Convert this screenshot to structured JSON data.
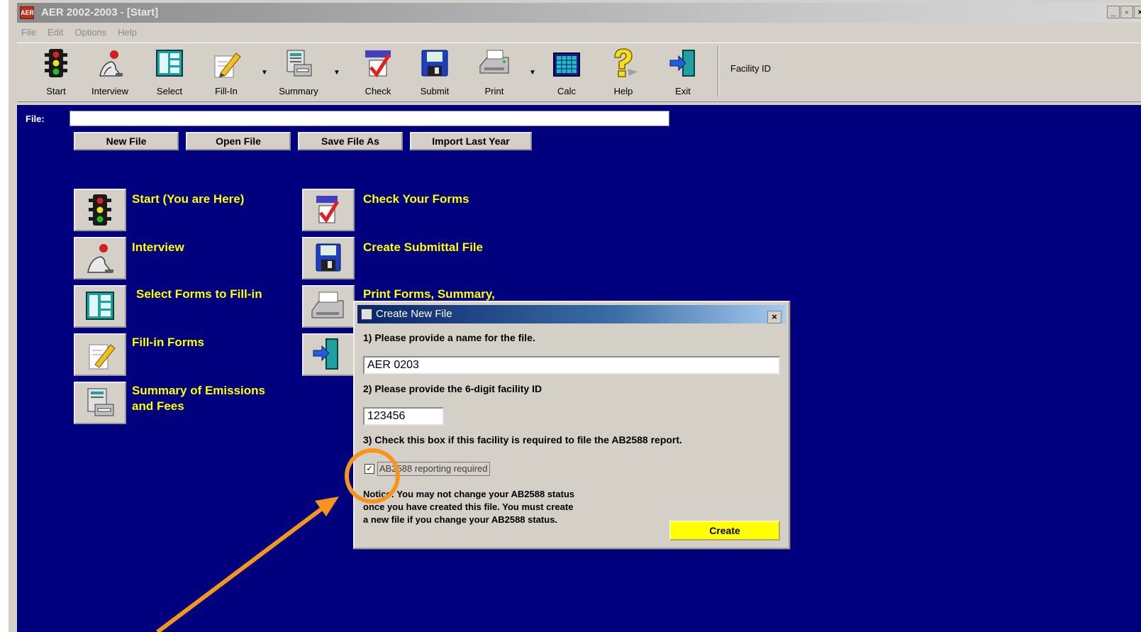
{
  "window": {
    "title": "AER 2002-2003 - [Start]",
    "app_icon_text": "AER",
    "controls": [
      "_",
      "▫",
      "×"
    ]
  },
  "menu": [
    "File",
    "Edit",
    "Options",
    "Help"
  ],
  "toolbar": {
    "items": [
      {
        "label": "Start",
        "icon": "traffic-light-icon"
      },
      {
        "label": "Interview",
        "icon": "interviewer-icon"
      },
      {
        "label": "Select",
        "icon": "form-list-icon"
      },
      {
        "label": "Fill-In",
        "icon": "pencil-icon"
      },
      {
        "label": "Summary",
        "icon": "summary-printer-icon"
      },
      {
        "label": "Check",
        "icon": "checkmark-icon"
      },
      {
        "label": "Submit",
        "icon": "floppy-disk-icon"
      },
      {
        "label": "Print",
        "icon": "printer-icon"
      },
      {
        "label": "Calc",
        "icon": "calculator-icon"
      },
      {
        "label": "Help",
        "icon": "question-mark-icon"
      },
      {
        "label": "Exit",
        "icon": "exit-door-icon"
      }
    ],
    "facility_id_label": "Facility ID"
  },
  "file_section": {
    "label": "File:",
    "value": "",
    "buttons": [
      "New File",
      "Open File",
      "Save File As",
      "Import Last Year"
    ]
  },
  "nav": {
    "left": [
      {
        "label": "Start (You are Here)"
      },
      {
        "label": "Interview"
      },
      {
        "label": "Select Forms to Fill-in"
      },
      {
        "label": "Fill-in Forms"
      },
      {
        "label_line1": "Summary of Emissions",
        "label_line2": "and Fees"
      }
    ],
    "right": [
      {
        "label": "Check Your Forms"
      },
      {
        "label": "Create Submittal File"
      },
      {
        "label": "Print Forms, Summary,"
      }
    ]
  },
  "dialog": {
    "title": "Create New File",
    "close": "×",
    "step1": "1) Please provide a name for the file.",
    "file_name": "AER 0203",
    "step2": "2) Please provide the 6-digit facility ID",
    "facility_id": "123456",
    "step3": "3) Check this box if this facility is required to file the AB2588 report.",
    "checkbox_label": "AB2588 reporting required",
    "checkbox_checked": true,
    "checkbox_mark": "✓",
    "notice_line1": "Notice: You may not change your AB2588 status",
    "notice_line2": "once you have created this file. You must create",
    "notice_line3": "a new file if you change your AB2588 status.",
    "create_label": "Create"
  },
  "colors": {
    "background": "#00007f",
    "nav_label": "#ffff00",
    "create_button": "#ffff00",
    "annotation": "#f7941d"
  }
}
